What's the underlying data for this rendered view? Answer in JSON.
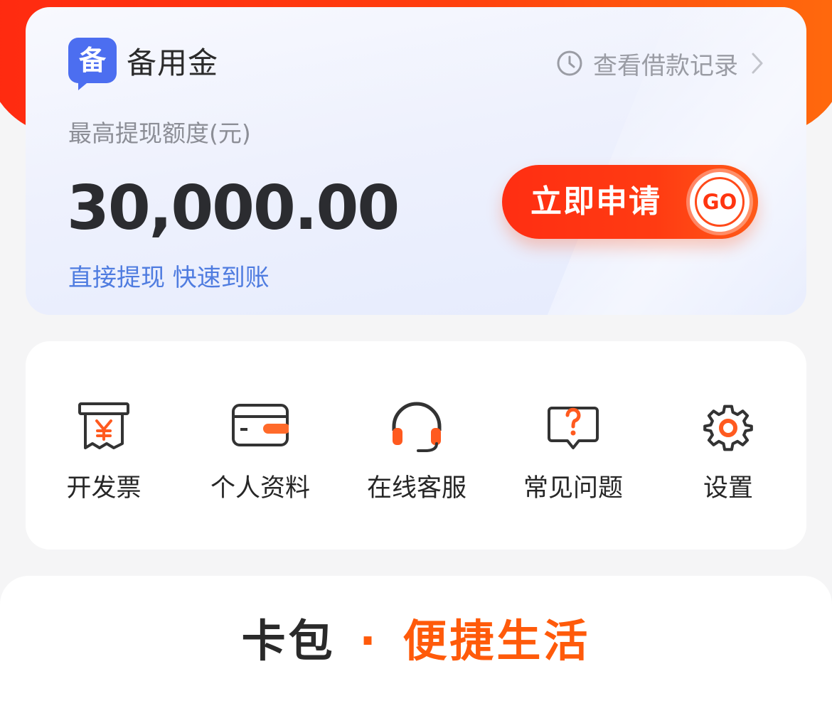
{
  "colors": {
    "banner": "#ff3d0e",
    "accent": "#ff3b12",
    "brand_blue": "#4f7ce0",
    "text_dark": "#262626",
    "text_muted": "#9a9ca4"
  },
  "reserve_card": {
    "logo_icon": "reserve-logo-icon",
    "logo_char": "备",
    "title": "备用金",
    "history_link": "查看借款记录",
    "limit_label": "最高提现额度(元)",
    "limit_amount": "30,000.00",
    "apply_button": "立即申请",
    "go_badge": "GO",
    "slogan": "直接提现 快速到账"
  },
  "tools": {
    "items": [
      {
        "label": "开发票",
        "icon": "invoice-icon"
      },
      {
        "label": "个人资料",
        "icon": "card-icon"
      },
      {
        "label": "在线客服",
        "icon": "headset-icon"
      },
      {
        "label": "常见问题",
        "icon": "help-icon"
      },
      {
        "label": "设置",
        "icon": "gear-icon"
      }
    ]
  },
  "promo": {
    "part1": "卡包",
    "separator": "·",
    "part2": "便捷生活"
  }
}
